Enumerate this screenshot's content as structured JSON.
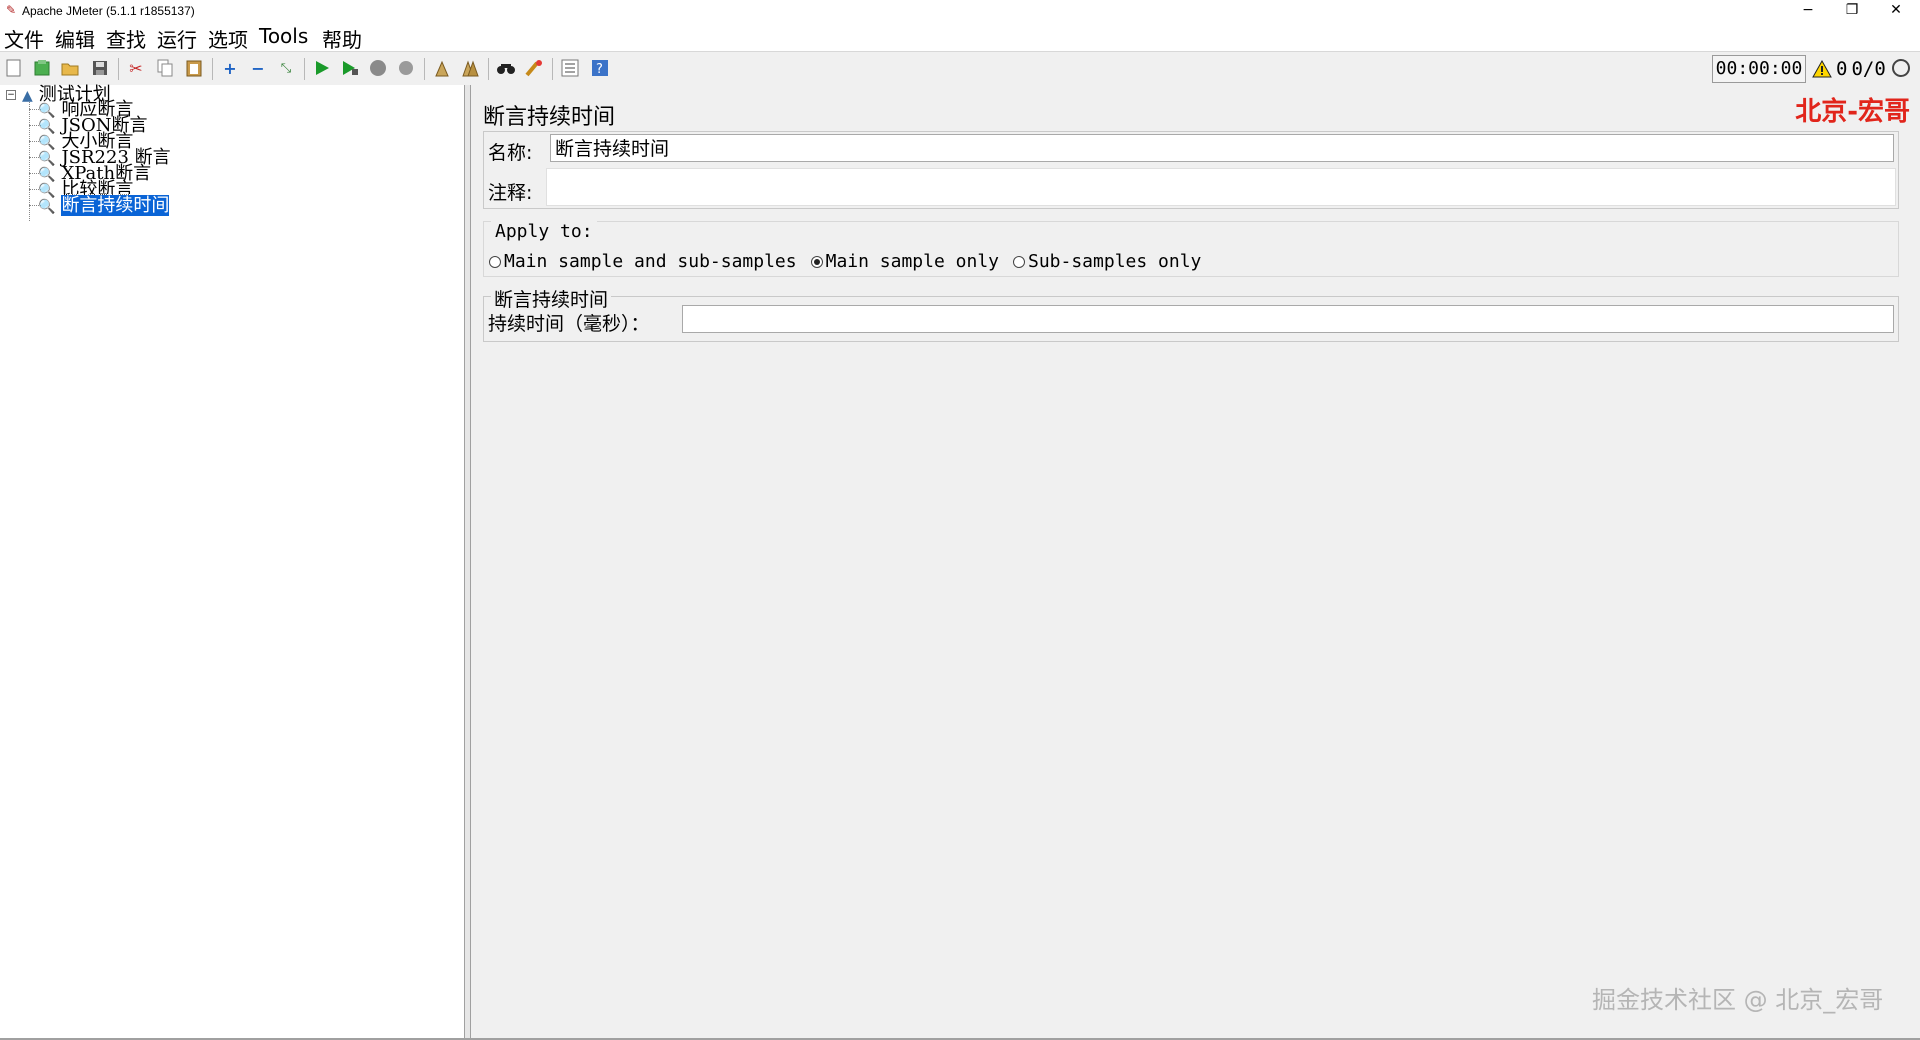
{
  "window": {
    "title": "Apache JMeter (5.1.1 r1855137)",
    "controls": [
      "−",
      "❐",
      "✕"
    ]
  },
  "menu": [
    "文件",
    "编辑",
    "查找",
    "运行",
    "选项",
    "Tools",
    "帮助"
  ],
  "toolbar": {
    "icons": [
      "new-icon",
      "templates-icon",
      "open-icon",
      "save-icon",
      "cut-icon",
      "copy-icon",
      "paste-icon",
      "expand-icon",
      "collapse-icon",
      "toggle-icon",
      "start-icon",
      "start-no-pause-icon",
      "stop-icon",
      "shutdown-icon",
      "clear-icon",
      "clear-all-icon",
      "search-icon",
      "reset-search-icon",
      "function-helper-icon",
      "help-icon"
    ],
    "timer": "00:00:00",
    "warning_count": "0",
    "threads": "0/0"
  },
  "tree": {
    "root": "测试计划",
    "items": [
      "响应断言",
      "JSON断言",
      "大小断言",
      "JSR223 断言",
      "XPath断言",
      "比较断言",
      "断言持续时间"
    ],
    "selected_index": 6
  },
  "panel": {
    "title": "断言持续时间",
    "watermark": "北京-宏哥",
    "name_label": "名称:",
    "name_value": "断言持续时间",
    "comment_label": "注释:",
    "comment_value": "",
    "apply_to_label": "Apply to:",
    "apply_options": [
      "Main sample and sub-samples",
      "Main sample only",
      "Sub-samples only"
    ],
    "apply_selected": 1,
    "duration_section": "断言持续时间",
    "duration_label": "持续时间（毫秒）：",
    "duration_value": ""
  },
  "footer_watermark": "掘金技术社区 @ 北京_宏哥"
}
